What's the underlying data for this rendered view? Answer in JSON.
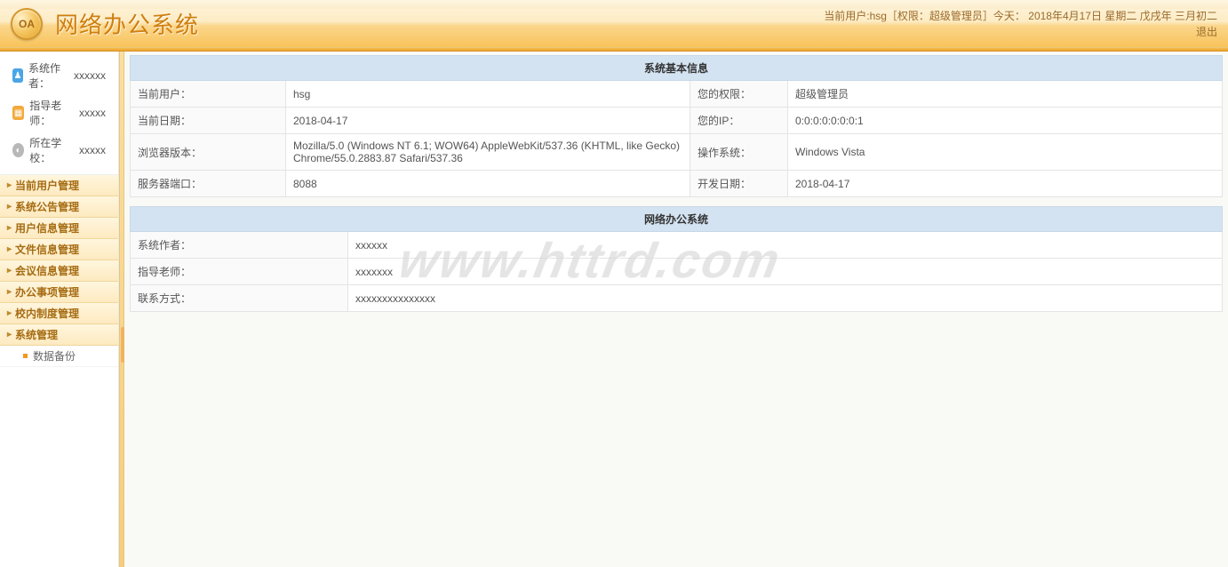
{
  "header": {
    "system_title": "网络办公系统",
    "logo_text": "OA",
    "status_line": "当前用户:hsg［权限：超级管理员］今天： 2018年4月17日 星期二 戊戌年 三月初二",
    "logout": "退出"
  },
  "sidebar": {
    "info": {
      "author_label": "系统作者：",
      "author_val": "xxxxxx",
      "teacher_label": "指导老师：",
      "teacher_val": "xxxxx",
      "school_label": "所在学校：",
      "school_val": "xxxxx"
    },
    "menu": [
      "当前用户管理",
      "系统公告管理",
      "用户信息管理",
      "文件信息管理",
      "会议信息管理",
      "办公事项管理",
      "校内制度管理",
      "系统管理"
    ],
    "sub_item": "数据备份"
  },
  "table1": {
    "title": "系统基本信息",
    "rows": [
      {
        "l1": "当前用户：",
        "v1": "hsg",
        "l2": "您的权限：",
        "v2": "超级管理员"
      },
      {
        "l1": "当前日期：",
        "v1": "2018-04-17",
        "l2": "您的IP：",
        "v2": "0:0:0:0:0:0:0:1"
      },
      {
        "l1": "浏览器版本：",
        "v1": "Mozilla/5.0 (Windows NT 6.1; WOW64) AppleWebKit/537.36 (KHTML, like Gecko) Chrome/55.0.2883.87 Safari/537.36",
        "l2": "操作系统：",
        "v2": "Windows Vista"
      },
      {
        "l1": "服务器端口：",
        "v1": "8088",
        "l2": "开发日期：",
        "v2": "2018-04-17"
      }
    ]
  },
  "table2": {
    "title": "网络办公系统",
    "rows": [
      {
        "l": "系统作者：",
        "v": "xxxxxx"
      },
      {
        "l": "指导老师：",
        "v": "xxxxxxx"
      },
      {
        "l": "联系方式：",
        "v": "xxxxxxxxxxxxxxx"
      }
    ]
  },
  "watermark": "www.httrd.com"
}
